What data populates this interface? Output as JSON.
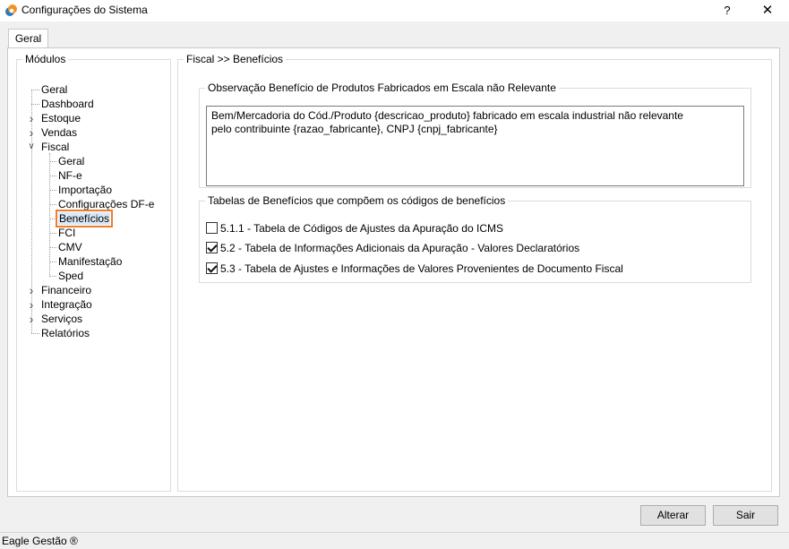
{
  "window": {
    "title": "Configurações do Sistema",
    "help_label": "?",
    "close_label": "✕",
    "icon": "app-logo-icon"
  },
  "tabs": [
    {
      "label": "Geral",
      "active": true
    }
  ],
  "modules": {
    "legend": "Módulos",
    "tree": [
      {
        "label": "Geral"
      },
      {
        "label": "Dashboard"
      },
      {
        "label": "Estoque",
        "expandable": true
      },
      {
        "label": "Vendas",
        "expandable": true
      },
      {
        "label": "Fiscal",
        "expanded": true
      },
      {
        "label": "Geral"
      },
      {
        "label": "NF-e"
      },
      {
        "label": "Importação"
      },
      {
        "label": "Configurações DF-e"
      },
      {
        "label": "Benefícios",
        "selected": true
      },
      {
        "label": "FCI"
      },
      {
        "label": "CMV"
      },
      {
        "label": "Manifestação"
      },
      {
        "label": "Sped"
      },
      {
        "label": "Financeiro",
        "expandable": true
      },
      {
        "label": "Integração",
        "expandable": true
      },
      {
        "label": "Serviços",
        "expandable": true
      },
      {
        "label": "Relatórios"
      }
    ]
  },
  "content": {
    "legend": "Fiscal >> Benefícios",
    "observation": {
      "legend": "Observação Benefício de Produtos Fabricados em Escala não Relevante",
      "text": "Bem/Mercadoria do Cód./Produto {descricao_produto} fabricado em escala industrial não relevante\npelo contribuinte {razao_fabricante}, CNPJ {cnpj_fabricante}"
    },
    "tables": {
      "legend": "Tabelas de Benefícios que compõem os códigos de benefícios",
      "items": [
        {
          "label": "5.1.1 - Tabela de Códigos de Ajustes da Apuração do ICMS",
          "checked": false
        },
        {
          "label": "5.2 - Tabela de Informações Adicionais da Apuração - Valores Declaratórios",
          "checked": true
        },
        {
          "label": "5.3 - Tabela de Ajustes e Informações de Valores Provenientes de Documento Fiscal",
          "checked": true
        }
      ]
    }
  },
  "buttons": {
    "alterar": "Alterar",
    "sair": "Sair"
  },
  "status_bar": {
    "text": "Eagle Gestão ®"
  },
  "colors": {
    "selection_highlight": "#f07d2a",
    "logo_orange": "#f39325",
    "logo_blue": "#2b7bbf"
  }
}
